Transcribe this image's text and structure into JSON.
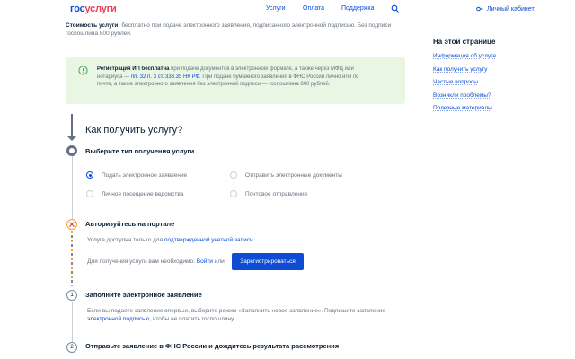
{
  "header": {
    "logo_part1": "гос",
    "logo_part2": "услуги",
    "nav": [
      "Услуги",
      "Оплата",
      "Поддержка"
    ],
    "account": "Личный кабинет",
    "search_icon": "search-icon",
    "account_icon": "key-icon"
  },
  "cost": {
    "label": "Стоимость услуги:",
    "line1": " бесплатно при подаче электронного заявления, подписанного электронной подписью. Без подписи",
    "line2": "госпошлина 800 рублей."
  },
  "notice": {
    "bold": "Регистрация ИП бесплатна",
    "t1": " при подаче документов в электронном формате, а также через МФЦ или",
    "t2": "нотариуса — ",
    "link": "пп. 32 п. 3 ст. 333.35 НК РФ",
    "t3": ". При подаче бумажного заявления в ФНС России лично или по",
    "t4": "почте, а также электронного заявления без электронной подписи — госпошлина 800 рублей.",
    "icon": "info-icon"
  },
  "sidebar": {
    "title": "На этой странице",
    "items": [
      "Информация об услуге",
      "Как получить услугу",
      "Частые вопросы",
      "Возникли проблемы?",
      "Полезные материалы"
    ]
  },
  "how": {
    "title": "Как получить услугу?"
  },
  "step_type": {
    "title": "Выберите тип получения услуги",
    "options": [
      "Подать электронное заявление",
      "Отправить электронные документы",
      "Личное посещение ведомства",
      "Почтовое отправление"
    ],
    "selected_index": 0
  },
  "step_auth": {
    "title": "Авторизуйтесь на портале",
    "t1": "Услуга доступна только для ",
    "link": "подтвержденной учетной записи",
    "t1_end": ".",
    "t2": "Для получения услуги вам необходимо: ",
    "login": "Войти",
    "or": " или",
    "button": "Зарегистрироваться"
  },
  "step1": {
    "num": "1",
    "title": "Заполните электронное заявление",
    "t1": "Если вы подаете заявление впервые, выберите режим «Заполнить новое заявление». Подпишите заявление",
    "link": "электронной подписью",
    "t2": ", чтобы не платить госпошлину."
  },
  "step2": {
    "num": "2",
    "title": "Отправьте заявление в ФНС России и дождитесь результата рассмотрения"
  },
  "colors": {
    "link": "#0d4cd3",
    "brand_red": "#ee3f58",
    "notice_bg": "#eaf6e4",
    "warning": "#f2a321"
  }
}
